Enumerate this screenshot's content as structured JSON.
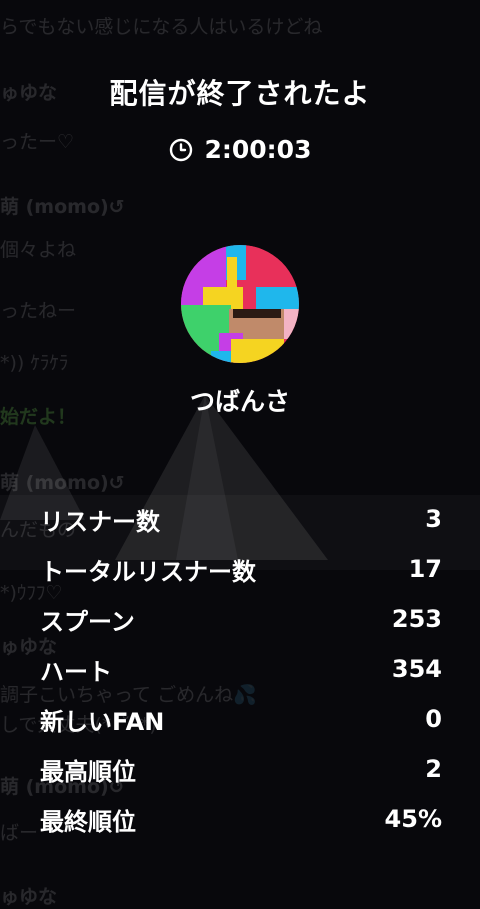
{
  "background_chat": [
    "らでもない感じになる人はいるけどね",
    "ゅゆな",
    "ったー♡",
    "萌 (momo)↺",
    "個々よね",
    "ったねー",
    "*)) ｹﾗｹﾗ",
    "始だよ！",
    "萌 (momo)↺",
    "んだもの",
    "*)ｳﾌﾌ♡",
    "ゅゆな",
    "調子こいちゃって ごめんね💦",
    "しで大丈夫(*´˘`*)",
    "萌 (momo)↺",
    "ばー",
    "ゅゆな"
  ],
  "title": "配信が終了されたよ",
  "duration": {
    "icon": "clock-icon",
    "value": "2:00:03"
  },
  "user": {
    "name": "つばんさ"
  },
  "stats": [
    {
      "label": "リスナー数",
      "value": "3"
    },
    {
      "label": "トータルリスナー数",
      "value": "17"
    },
    {
      "label": "スプーン",
      "value": "253"
    },
    {
      "label": "ハート",
      "value": "354"
    },
    {
      "label": "新しいFAN",
      "value": "0"
    },
    {
      "label": "最高順位",
      "value": "2"
    },
    {
      "label": "最終順位",
      "value": "45%"
    }
  ],
  "colors": {
    "background": "#08080c",
    "text": "#ffffff",
    "chat_highlight": "#7be05a"
  }
}
